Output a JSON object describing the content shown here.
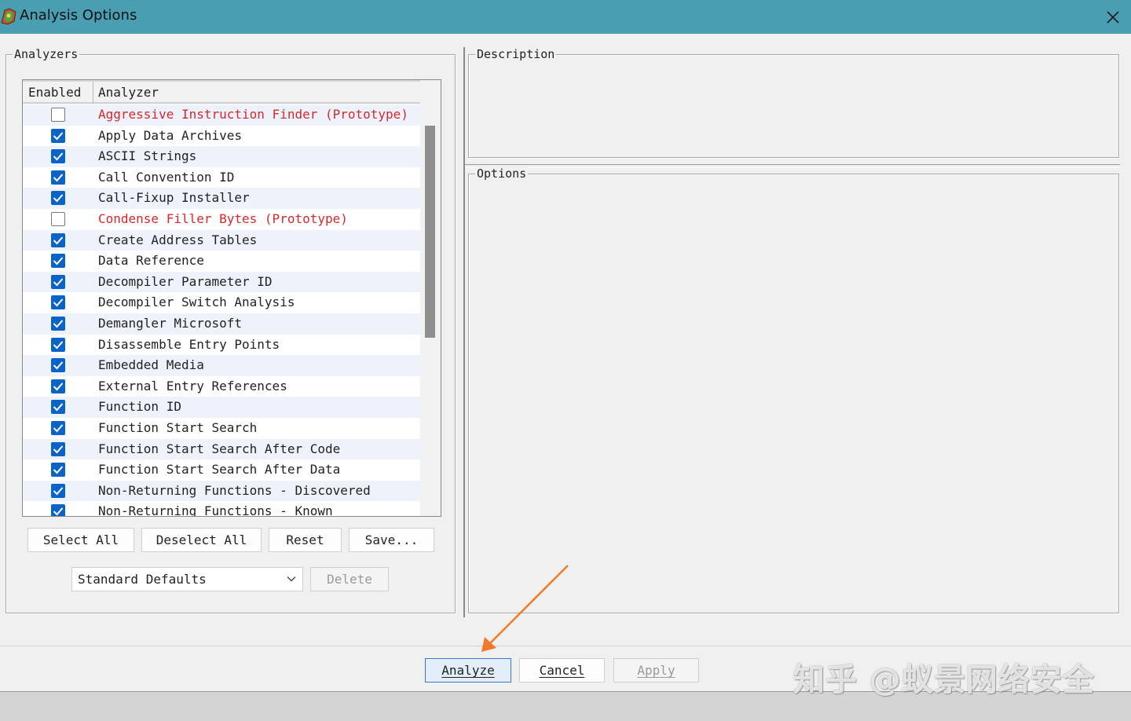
{
  "window": {
    "title": "Analysis Options"
  },
  "analyzers_panel": {
    "label": "Analyzers",
    "columns": [
      "Enabled",
      "Analyzer"
    ],
    "rows": [
      {
        "enabled": false,
        "name": "Aggressive Instruction Finder (Prototype)",
        "prototype": true
      },
      {
        "enabled": true,
        "name": "Apply Data Archives",
        "prototype": false
      },
      {
        "enabled": true,
        "name": "ASCII Strings",
        "prototype": false
      },
      {
        "enabled": true,
        "name": "Call Convention ID",
        "prototype": false
      },
      {
        "enabled": true,
        "name": "Call-Fixup Installer",
        "prototype": false
      },
      {
        "enabled": false,
        "name": "Condense Filler Bytes (Prototype)",
        "prototype": true
      },
      {
        "enabled": true,
        "name": "Create Address Tables",
        "prototype": false
      },
      {
        "enabled": true,
        "name": "Data Reference",
        "prototype": false
      },
      {
        "enabled": true,
        "name": "Decompiler Parameter ID",
        "prototype": false
      },
      {
        "enabled": true,
        "name": "Decompiler Switch Analysis",
        "prototype": false
      },
      {
        "enabled": true,
        "name": "Demangler Microsoft",
        "prototype": false
      },
      {
        "enabled": true,
        "name": "Disassemble Entry Points",
        "prototype": false
      },
      {
        "enabled": true,
        "name": "Embedded Media",
        "prototype": false
      },
      {
        "enabled": true,
        "name": "External Entry References",
        "prototype": false
      },
      {
        "enabled": true,
        "name": "Function ID",
        "prototype": false
      },
      {
        "enabled": true,
        "name": "Function Start Search",
        "prototype": false
      },
      {
        "enabled": true,
        "name": "Function Start Search After Code",
        "prototype": false
      },
      {
        "enabled": true,
        "name": "Function Start Search After Data",
        "prototype": false
      },
      {
        "enabled": true,
        "name": "Non-Returning Functions - Discovered",
        "prototype": false
      },
      {
        "enabled": true,
        "name": "Non-Returning Functions - Known",
        "prototype": false
      }
    ],
    "buttons": {
      "select_all": "Select All",
      "deselect_all": "Deselect All",
      "reset": "Reset",
      "save": "Save..."
    },
    "profile_select": {
      "value": "Standard Defaults"
    },
    "delete_label": "Delete"
  },
  "description_panel": {
    "label": "Description"
  },
  "options_panel": {
    "label": "Options"
  },
  "footer": {
    "analyze_label": "Analyze",
    "cancel_label": "Cancel",
    "apply_label": "Apply"
  },
  "watermark": "知乎 @蚁景网络安全",
  "colors": {
    "titlebar": "#4a9eb1",
    "checkbox_on": "#0a64c8",
    "prototype_text": "#d8282c",
    "annotation_arrow": "#f07a2a"
  },
  "icons": [
    "app-icon",
    "close-icon",
    "checkmark-icon",
    "chevron-down-icon"
  ]
}
